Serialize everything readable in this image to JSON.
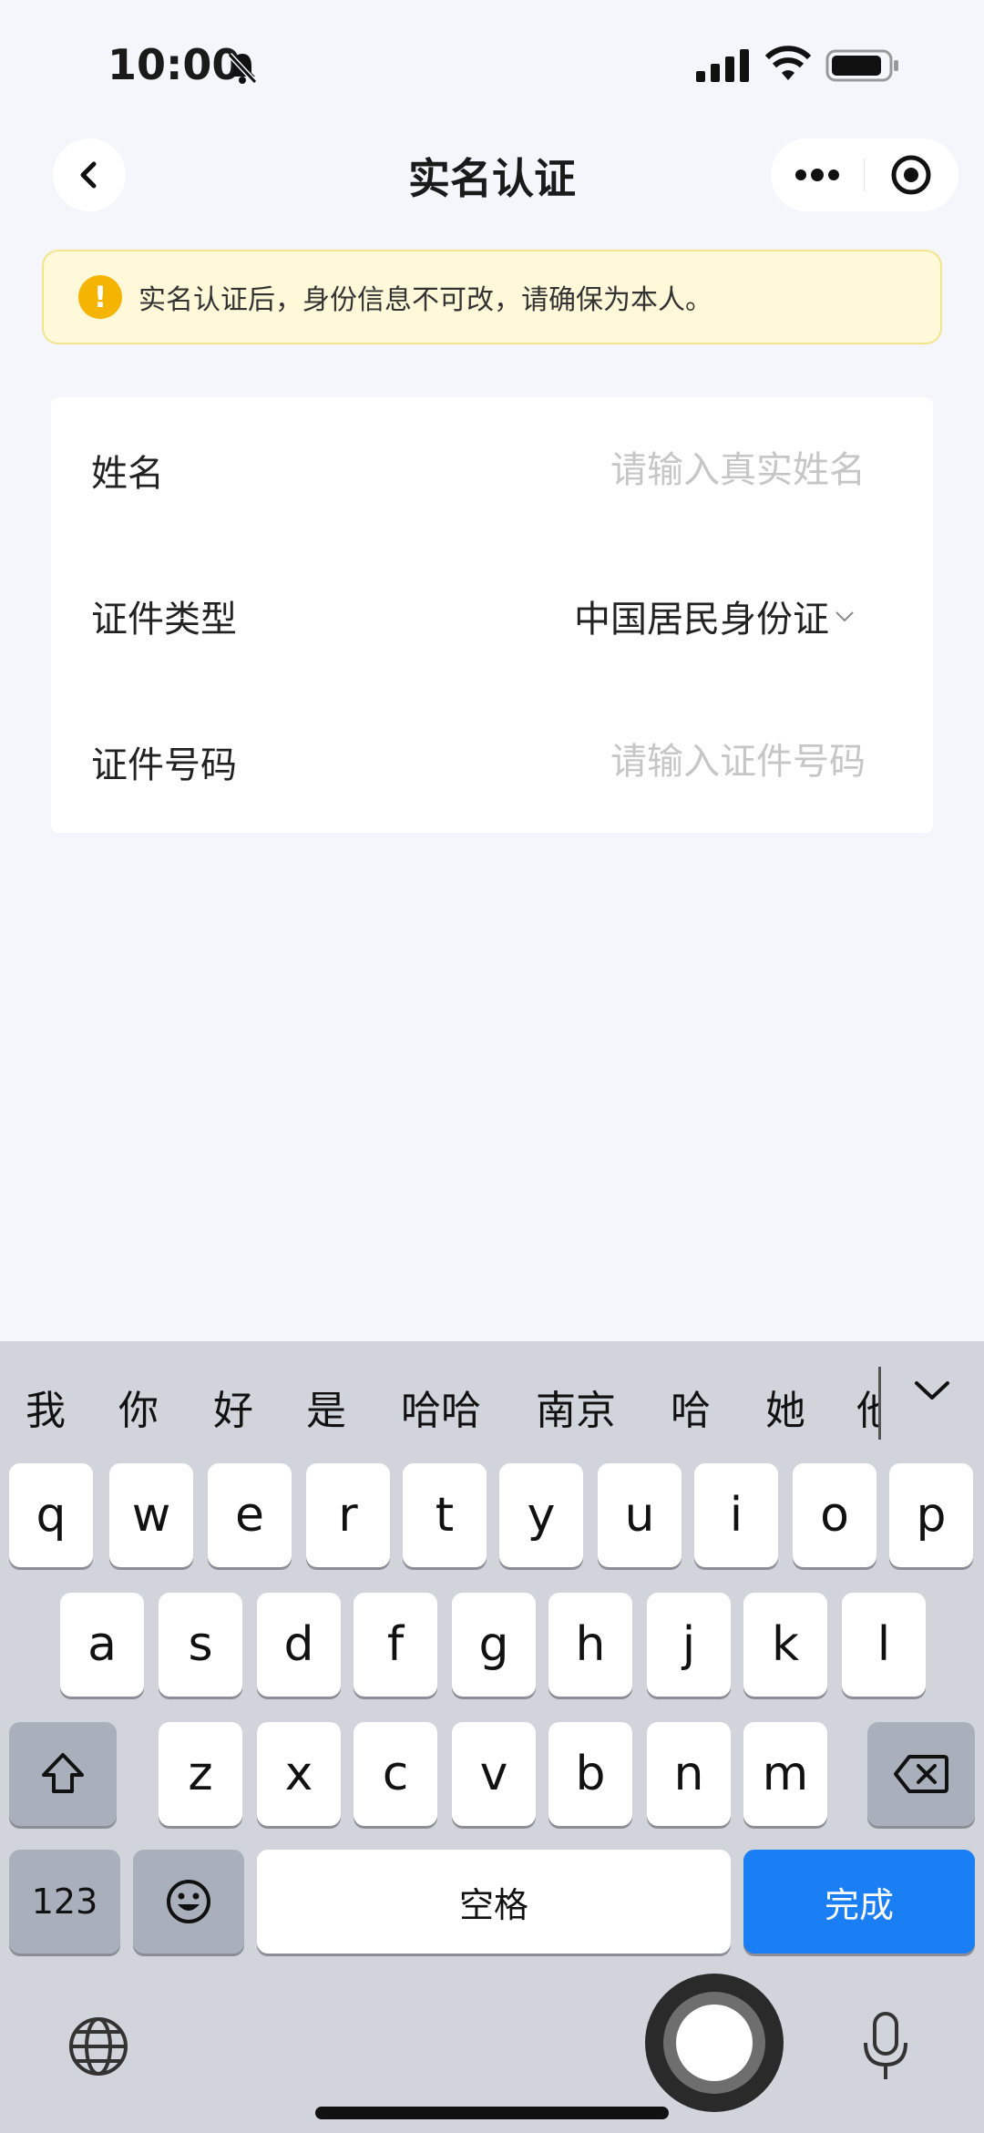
{
  "status_bar": {
    "time": "10:00"
  },
  "nav": {
    "title": "实名认证"
  },
  "notice": {
    "text": "实名认证后，身份信息不可改，请确保为本人。"
  },
  "form": {
    "name": {
      "label": "姓名",
      "placeholder": "请输入真实姓名"
    },
    "id_type": {
      "label": "证件类型",
      "value": "中国居民身份证"
    },
    "id_number": {
      "label": "证件号码",
      "placeholder": "请输入证件号码"
    }
  },
  "keyboard": {
    "candidates": [
      "我",
      "你",
      "好",
      "是",
      "哈哈",
      "南京",
      "哈",
      "她",
      "他"
    ],
    "row1": [
      "q",
      "w",
      "e",
      "r",
      "t",
      "y",
      "u",
      "i",
      "o",
      "p"
    ],
    "row2": [
      "a",
      "s",
      "d",
      "f",
      "g",
      "h",
      "j",
      "k",
      "l"
    ],
    "row3": [
      "z",
      "x",
      "c",
      "v",
      "b",
      "n",
      "m"
    ],
    "numbers_label": "123",
    "space_label": "空格",
    "done_label": "完成",
    "accent_color": "#1a7ef5"
  },
  "icons": {
    "back": "chevron-left-icon",
    "more": "more-icon",
    "close": "record-target-icon",
    "warning": "warning-icon",
    "shift": "shift-icon",
    "delete": "backspace-icon",
    "emoji": "emoji-icon",
    "globe": "globe-icon",
    "mic": "microphone-icon"
  }
}
